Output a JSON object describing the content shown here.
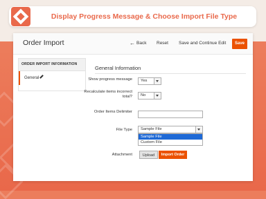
{
  "banner": {
    "title": "Display Progress Message & Choose Import File Type",
    "logo": "logo-icon"
  },
  "header": {
    "page_title": "Order Import",
    "back_label": "Back",
    "reset_label": "Reset",
    "save_continue_label": "Save and Continue Edit",
    "save_label": "Save"
  },
  "sidebar": {
    "title": "ORDER IMPORT INFORMATION",
    "items": [
      {
        "label": "General",
        "icon": "pencil-icon"
      }
    ]
  },
  "section": {
    "title": "General Information"
  },
  "form": {
    "show_progress": {
      "label": "Show progress message",
      "value": "Yes"
    },
    "recalculate": {
      "label": "Recalculate items incorrect total?",
      "value": "No"
    },
    "delimiter": {
      "label": "Order Items Delimiter",
      "value": ""
    },
    "file_type": {
      "label": "File Type",
      "value": "Sample File",
      "options": [
        "Sample File",
        "Custom File"
      ],
      "highlighted_option": "Sample File"
    },
    "attachment": {
      "label": "Attachment",
      "upload_label": "Upload",
      "import_label": "Import Order"
    }
  },
  "colors": {
    "accent": "#eb5202",
    "banner_title": "#e9694b",
    "background": "#ec7d5c",
    "option_highlight": "#1e69d6"
  }
}
